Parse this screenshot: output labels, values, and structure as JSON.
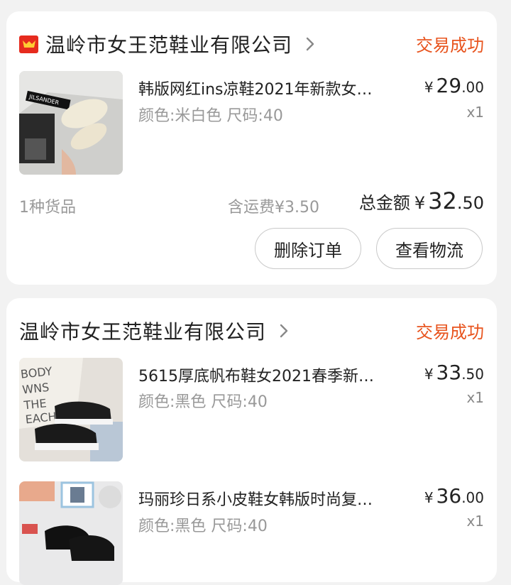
{
  "orders": [
    {
      "shop_name": "温岭市女王范鞋业有限公司",
      "status": "交易成功",
      "shop_badge_icon": "tmall-shop-icon",
      "items": [
        {
          "title": "韩版网红ins凉鞋2021年新款女…",
          "spec": "颜色:米白色 尺码:40",
          "price_yen": "¥",
          "price_int": "29",
          "price_dec": ".00",
          "qty": "x1"
        }
      ],
      "summary": {
        "count": "1种货品",
        "shipping": "含运费¥3.50",
        "total_label": "总金额",
        "total_yen": "¥",
        "total_int": "32",
        "total_dec": ".50"
      },
      "buttons": {
        "delete": "删除订单",
        "track": "查看物流"
      }
    },
    {
      "shop_name": "温岭市女王范鞋业有限公司",
      "status": "交易成功",
      "items": [
        {
          "title": "5615厚底帆布鞋女2021春季新…",
          "spec": "颜色:黑色 尺码:40",
          "price_yen": "¥",
          "price_int": "33",
          "price_dec": ".50",
          "qty": "x1"
        },
        {
          "title": "玛丽珍日系小皮鞋女韩版时尚复…",
          "spec": "颜色:黑色 尺码:40",
          "price_yen": "¥",
          "price_int": "36",
          "price_dec": ".00",
          "qty": "x1"
        }
      ]
    }
  ],
  "colors": {
    "status": "#e8541e",
    "badge": "#e62b1e",
    "muted": "#999999",
    "background": "#f2f2f2"
  }
}
